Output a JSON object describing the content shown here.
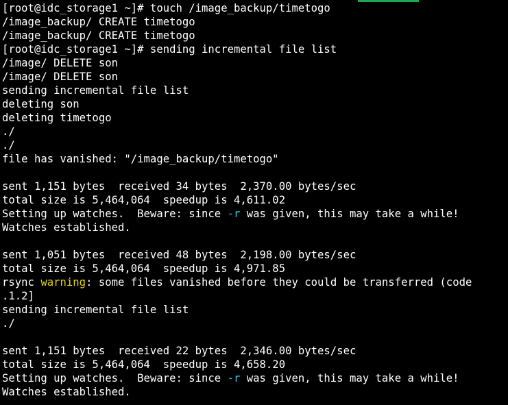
{
  "theme": {
    "background": "#000000",
    "foreground": "#ffffff",
    "option_highlight": "#35c3e5",
    "warning_highlight": "#e7d400",
    "tab_indicator": "#1fa74d"
  },
  "terminal": {
    "lines": [
      {
        "type": "plain",
        "text": "[root@idc_storage1 ~]# touch /image_backup/timetogo"
      },
      {
        "type": "plain",
        "text": "/image_backup/ CREATE timetogo"
      },
      {
        "type": "plain",
        "text": "/image_backup/ CREATE timetogo"
      },
      {
        "type": "plain",
        "text": "[root@idc_storage1 ~]# sending incremental file list"
      },
      {
        "type": "plain",
        "text": "/image/ DELETE son"
      },
      {
        "type": "plain",
        "text": "/image/ DELETE son"
      },
      {
        "type": "plain",
        "text": "sending incremental file list"
      },
      {
        "type": "plain",
        "text": "deleting son"
      },
      {
        "type": "plain",
        "text": "deleting timetogo"
      },
      {
        "type": "plain",
        "text": "./"
      },
      {
        "type": "plain",
        "text": "./"
      },
      {
        "type": "plain",
        "text": "file has vanished: \"/image_backup/timetogo\""
      },
      {
        "type": "plain",
        "text": ""
      },
      {
        "type": "plain",
        "text": "sent 1,151 bytes  received 34 bytes  2,370.00 bytes/sec"
      },
      {
        "type": "plain",
        "text": "total size is 5,464,064  speedup is 4,611.02"
      },
      {
        "type": "option",
        "before": "Setting up watches.  Beware: since ",
        "flag": "-r",
        "after": " was given, this may take a while!"
      },
      {
        "type": "plain",
        "text": "Watches established."
      },
      {
        "type": "plain",
        "text": ""
      },
      {
        "type": "plain",
        "text": "sent 1,051 bytes  received 48 bytes  2,198.00 bytes/sec"
      },
      {
        "type": "plain",
        "text": "total size is 5,464,064  speedup is 4,971.85"
      },
      {
        "type": "warning",
        "before": "rsync ",
        "keyword": "warning",
        "after": ": some files vanished before they could be transferred (code"
      },
      {
        "type": "plain",
        "text": ".1.2]"
      },
      {
        "type": "plain",
        "text": "sending incremental file list"
      },
      {
        "type": "plain",
        "text": "./"
      },
      {
        "type": "plain",
        "text": ""
      },
      {
        "type": "plain",
        "text": "sent 1,151 bytes  received 22 bytes  2,346.00 bytes/sec"
      },
      {
        "type": "plain",
        "text": "total size is 5,464,064  speedup is 4,658.20"
      },
      {
        "type": "option",
        "before": "Setting up watches.  Beware: since ",
        "flag": "-r",
        "after": " was given, this may take a while!"
      },
      {
        "type": "plain",
        "text": "Watches established."
      }
    ]
  }
}
